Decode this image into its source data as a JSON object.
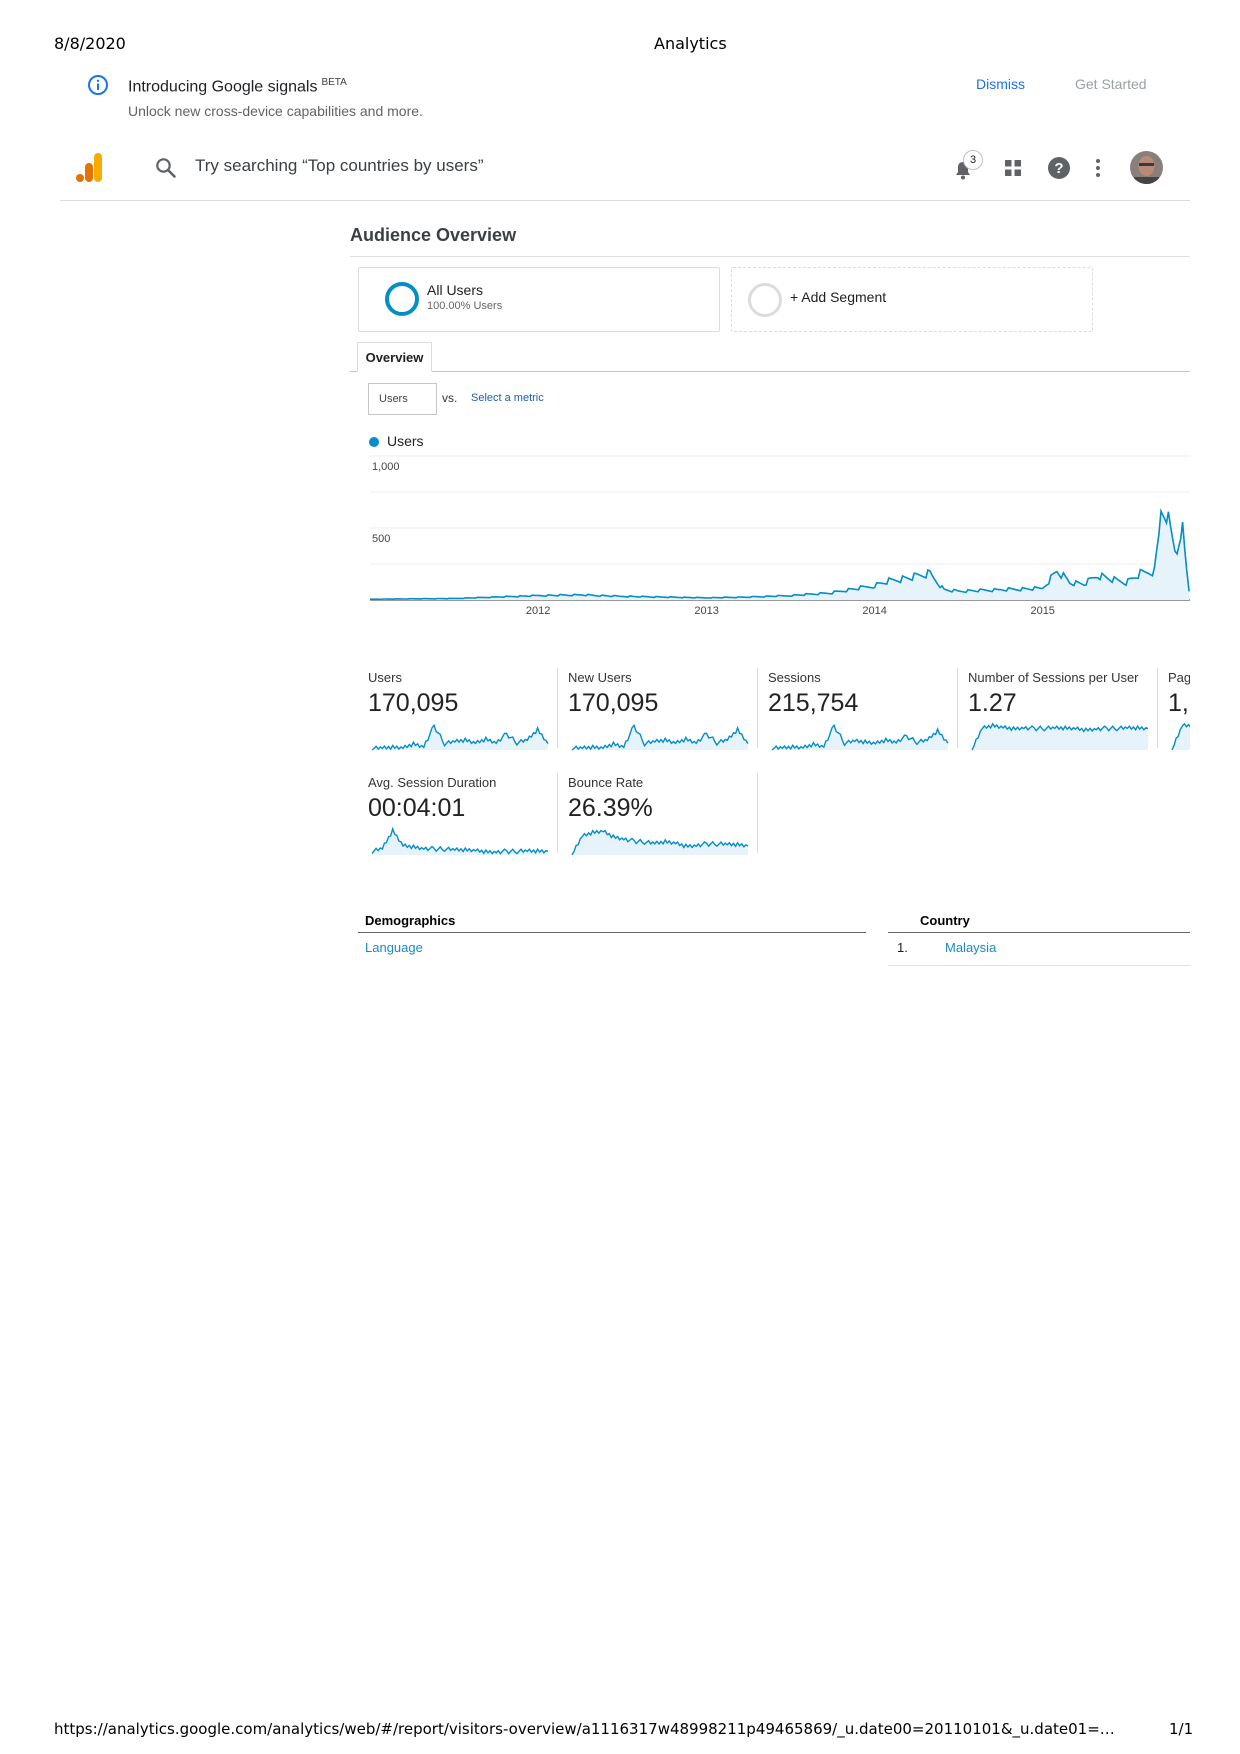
{
  "print_header": {
    "date": "8/8/2020",
    "title": "Analytics"
  },
  "banner": {
    "title": "Introducing Google signals",
    "badge": "BETA",
    "subtitle": "Unlock new cross-device capabilities and more.",
    "dismiss": "Dismiss",
    "get_started": "Get Started"
  },
  "appbar": {
    "search_placeholder": "Try searching “Top countries by users”",
    "notification_count": "3"
  },
  "report": {
    "title": "Audience Overview",
    "segments": [
      {
        "name": "All Users",
        "detail": "100.00% Users"
      },
      {
        "name": "+ Add Segment"
      }
    ],
    "tab": "Overview",
    "metric_select": "Users",
    "vs": "vs.",
    "select_metric": "Select a metric"
  },
  "chart_data": {
    "type": "line",
    "series": [
      {
        "name": "Users",
        "x": [
          "2011-01",
          "2011-04",
          "2011-07",
          "2011-10",
          "2012-01",
          "2012-04",
          "2012-07",
          "2012-10",
          "2013-01",
          "2013-04",
          "2013-07",
          "2013-10",
          "2014-01",
          "2014-02",
          "2014-04",
          "2014-05",
          "2014-06",
          "2014-07",
          "2014-10",
          "2015-01",
          "2015-02",
          "2015-03",
          "2015-04",
          "2015-05",
          "2015-06",
          "2015-07",
          "2015-08",
          "2015-09",
          "2015-09-15",
          "2015-10",
          "2015-10-20",
          "2015-11",
          "2015-11-10",
          "2015-11-15"
        ],
        "values": [
          5,
          8,
          10,
          20,
          30,
          35,
          25,
          20,
          15,
          20,
          30,
          50,
          100,
          130,
          160,
          180,
          70,
          60,
          70,
          80,
          200,
          120,
          110,
          170,
          140,
          120,
          180,
          200,
          550,
          560,
          300,
          520,
          200,
          60
        ]
      }
    ],
    "x_ticks": [
      "2012",
      "2013",
      "2014",
      "2015"
    ],
    "y_ticks": [
      "1,000",
      "500"
    ],
    "ylim": [
      0,
      1000
    ],
    "color": "#058dc7",
    "grid": true,
    "legend": "top-left"
  },
  "kpis": [
    {
      "label": "Users",
      "value": "170,095",
      "spark": [
        2,
        2,
        3,
        3,
        8,
        5,
        30,
        8,
        10,
        12,
        9,
        14,
        10,
        20,
        9,
        12,
        25,
        8
      ]
    },
    {
      "label": "New Users",
      "value": "170,095",
      "spark": [
        2,
        2,
        3,
        3,
        8,
        5,
        30,
        8,
        10,
        12,
        9,
        14,
        10,
        20,
        9,
        12,
        25,
        8
      ]
    },
    {
      "label": "Sessions",
      "value": "215,754",
      "spark": [
        2,
        2,
        3,
        3,
        7,
        5,
        28,
        8,
        10,
        9,
        8,
        12,
        10,
        16,
        9,
        11,
        22,
        8
      ]
    },
    {
      "label": "Number of Sessions per User",
      "value": "1.27",
      "spark": [
        0,
        18,
        20,
        19,
        18,
        19,
        18,
        18,
        18,
        18,
        18,
        17,
        18,
        18,
        18,
        18,
        18,
        18
      ]
    },
    {
      "label": "Pages / Session",
      "value": "1,",
      "spark": [
        0,
        12,
        12,
        12,
        12,
        12,
        12,
        12,
        12,
        12,
        12,
        12,
        12,
        12,
        12,
        12,
        12,
        12
      ]
    },
    {
      "label": "Avg. Session Duration",
      "value": "00:04:01",
      "spark": [
        3,
        5,
        20,
        8,
        7,
        6,
        5,
        5,
        4,
        4,
        4,
        3,
        3,
        3,
        3,
        3,
        3,
        3
      ]
    },
    {
      "label": "Bounce Rate",
      "value": "26.39%",
      "spark": [
        0,
        20,
        24,
        26,
        20,
        18,
        15,
        14,
        12,
        14,
        13,
        10,
        11,
        12,
        12,
        11,
        11,
        10
      ]
    }
  ],
  "demographics": {
    "header": "Demographics",
    "link": "Language"
  },
  "country_table": {
    "header": "Country",
    "rows": [
      {
        "rank": "1.",
        "name": "Malaysia"
      }
    ]
  },
  "footer": {
    "url": "https://analytics.google.com/analytics/web/#/report/visitors-overview/a1116317w48998211p49465869/_u.date00=20110101&_u.date01=…",
    "page": "1/1"
  }
}
